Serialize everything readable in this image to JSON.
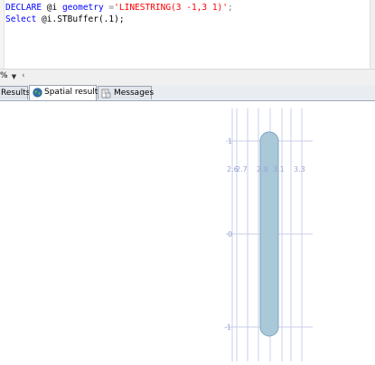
{
  "editor": {
    "line1": {
      "kw1": "DECLARE",
      "var": " @i ",
      "kw2": "geometry",
      "eq": " =",
      "str": "'LINESTRING(3 -1,3 1)'",
      "end": ";"
    },
    "line2": {
      "kw1": "Select",
      "rest": " @i.STBuffer(.1);"
    }
  },
  "zoombar": {
    "zoom_value": "%",
    "arrow": "‹"
  },
  "tabs": {
    "results": "Results",
    "spatial": "Spatial results",
    "messages": "Messages"
  },
  "spatial": {
    "x_labels": [
      "2.6",
      "2.7",
      "2.9",
      "3.1",
      "3.3"
    ],
    "y_labels": [
      "1",
      "0",
      "-1"
    ],
    "shape_fill": "#a9c8d8",
    "shape_stroke": "#7ea6c0",
    "grid_color": "#c9cfea",
    "label_color": "#9aa3d6"
  }
}
